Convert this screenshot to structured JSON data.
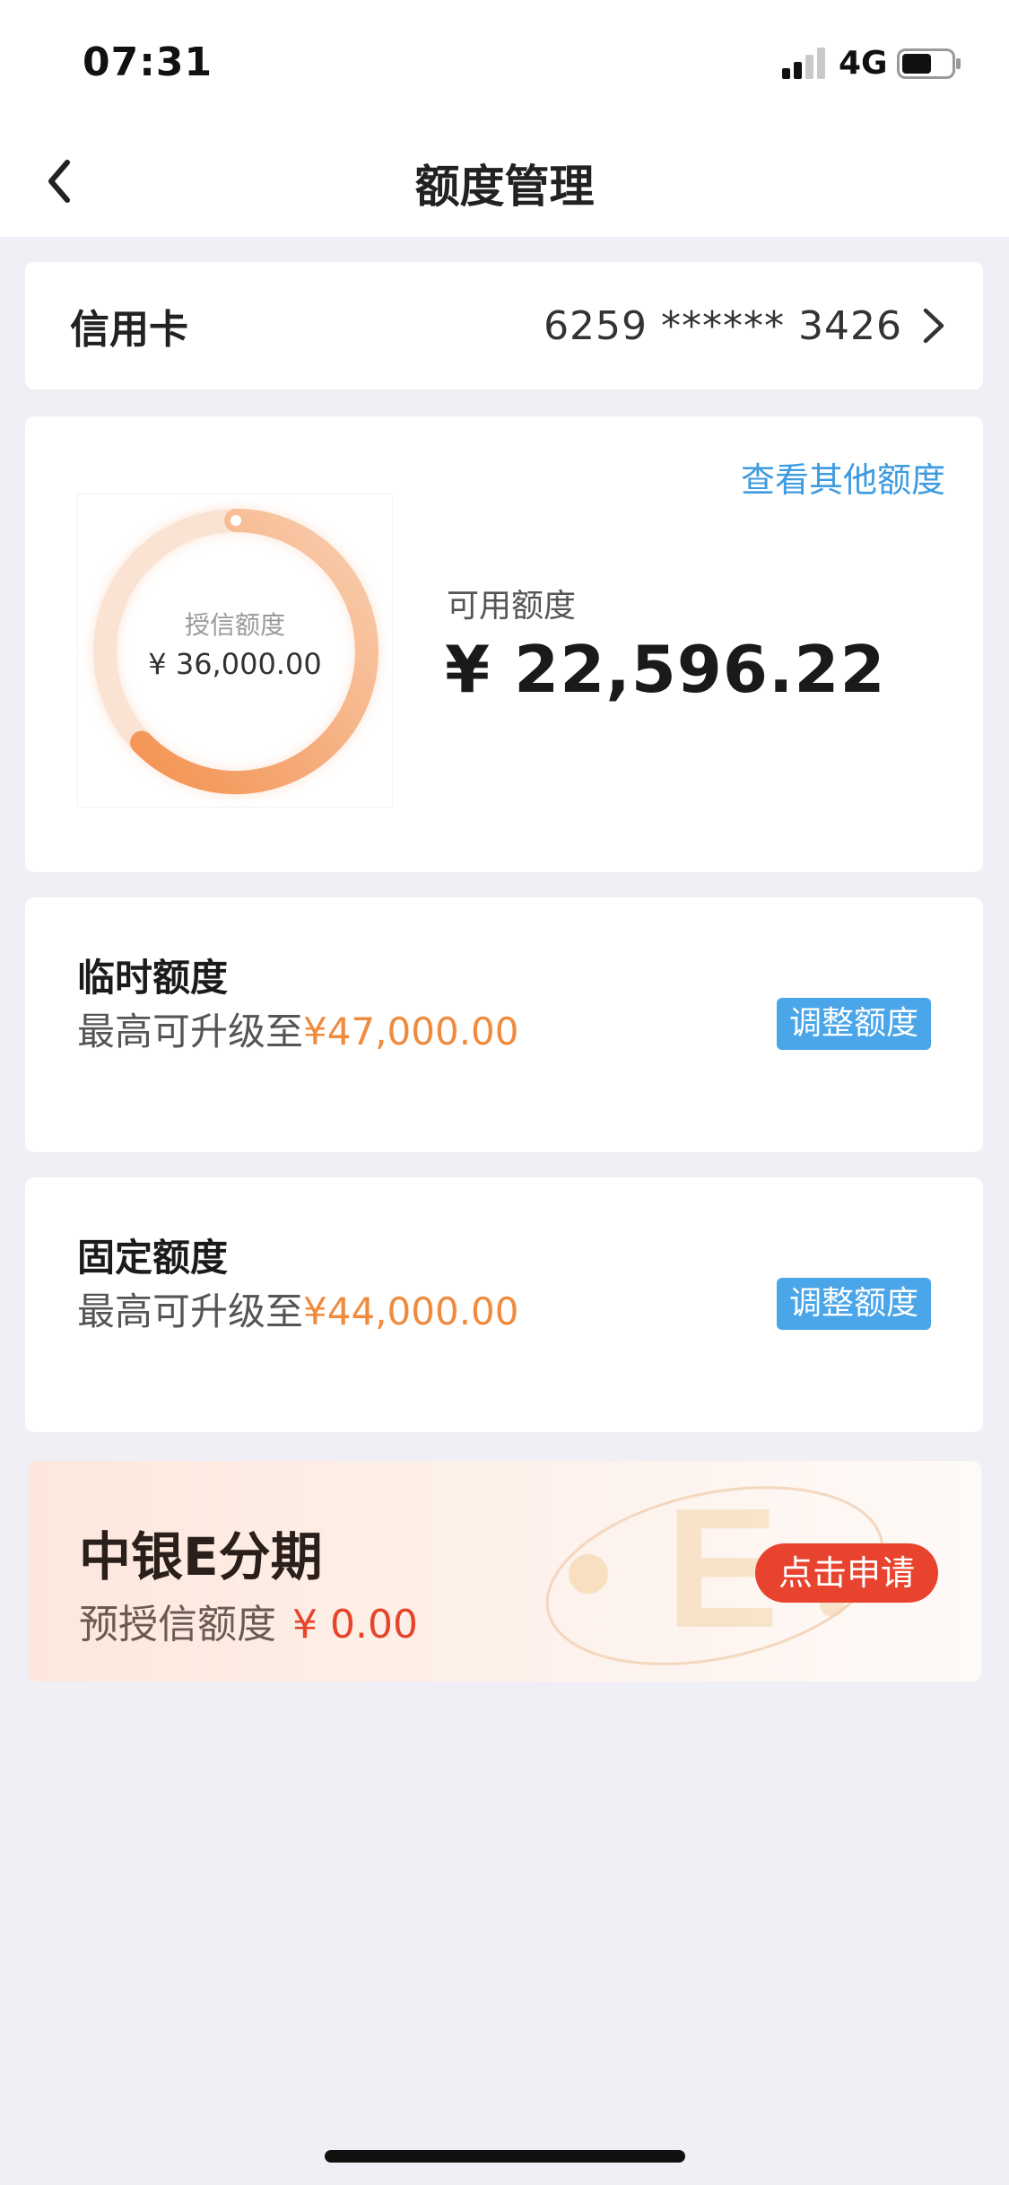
{
  "status_bar": {
    "time": "07:31",
    "network": "4G"
  },
  "nav": {
    "title": "额度管理"
  },
  "card_selector": {
    "label": "信用卡",
    "card_number": "6259 ****** 3426"
  },
  "quota": {
    "other_link": "查看其他额度",
    "ring_label": "授信额度",
    "ring_value": "¥ 36,000.00",
    "available_label": "可用额度",
    "available_value": "¥ 22,596.22",
    "available_fraction": 0.6277
  },
  "temporary": {
    "title": "临时额度",
    "desc_prefix": "最高可升级至",
    "amount": "¥47,000.00",
    "button": "调整额度"
  },
  "fixed": {
    "title": "固定额度",
    "desc_prefix": "最高可升级至",
    "amount": "¥44,000.00",
    "button": "调整额度"
  },
  "e_installment": {
    "title": "中银E分期",
    "desc_prefix": "预授信额度",
    "amount": "¥ 0.00",
    "button": "点击申请"
  },
  "colors": {
    "accent_blue": "#4aa5e9",
    "accent_orange": "#f08a3c",
    "accent_red": "#e8432f"
  }
}
